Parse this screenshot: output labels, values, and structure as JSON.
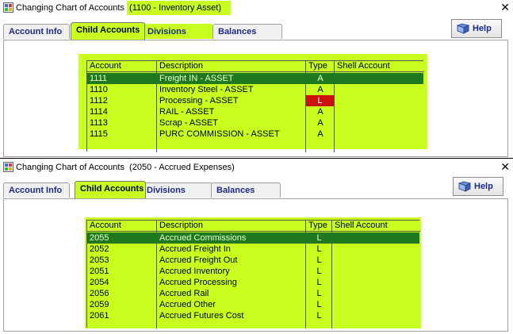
{
  "window1": {
    "title": "Changing Chart of Accounts",
    "subtitle": "(1100 - Inventory Asset)",
    "tabs": [
      "Account Info",
      "Child Accounts",
      "Divisions",
      "Balances"
    ],
    "help_label": "Help",
    "columns": [
      "Account",
      "Description",
      "Type",
      "Shell Account"
    ],
    "rows": [
      {
        "account": "1111",
        "description": "Freight IN - ASSET",
        "type": "A",
        "shell": ""
      },
      {
        "account": "1110",
        "description": "Inventory Steel - ASSET",
        "type": "A",
        "shell": ""
      },
      {
        "account": "1112",
        "description": "Processing - ASSET",
        "type": "L",
        "shell": ""
      },
      {
        "account": "1114",
        "description": "RAIL - ASSET",
        "type": "A",
        "shell": ""
      },
      {
        "account": "1113",
        "description": "Scrap - ASSET",
        "type": "A",
        "shell": ""
      },
      {
        "account": "1115",
        "description": "PURC COMMISSION - ASSET",
        "type": "A",
        "shell": ""
      }
    ]
  },
  "window2": {
    "title": "Changing Chart of Accounts",
    "subtitle": "(2050 - Accrued Expenses)",
    "tabs": [
      "Account Info",
      "Child Accounts",
      "Divisions",
      "Balances"
    ],
    "help_label": "Help",
    "columns": [
      "Account",
      "Description",
      "Type",
      "Shell Account"
    ],
    "rows": [
      {
        "account": "2055",
        "description": "Accrued Commissions",
        "type": "L",
        "shell": ""
      },
      {
        "account": "2052",
        "description": "Accrued Freight In",
        "type": "L",
        "shell": ""
      },
      {
        "account": "2053",
        "description": "Accrued Freight Out",
        "type": "L",
        "shell": ""
      },
      {
        "account": "2051",
        "description": "Accrued Inventory",
        "type": "L",
        "shell": ""
      },
      {
        "account": "2054",
        "description": "Accrued Processing",
        "type": "L",
        "shell": ""
      },
      {
        "account": "2056",
        "description": "Accrued Rail",
        "type": "L",
        "shell": ""
      },
      {
        "account": "2059",
        "description": "Accrued Other",
        "type": "L",
        "shell": ""
      },
      {
        "account": "2061",
        "description": "Accrued Futures Cost",
        "type": "L",
        "shell": ""
      }
    ]
  },
  "colors": {
    "highlight": "#c8ff1e",
    "selected_row": "#1f7a1f",
    "liability_flag": "#cc1111",
    "tab_text": "#1b2b85"
  }
}
